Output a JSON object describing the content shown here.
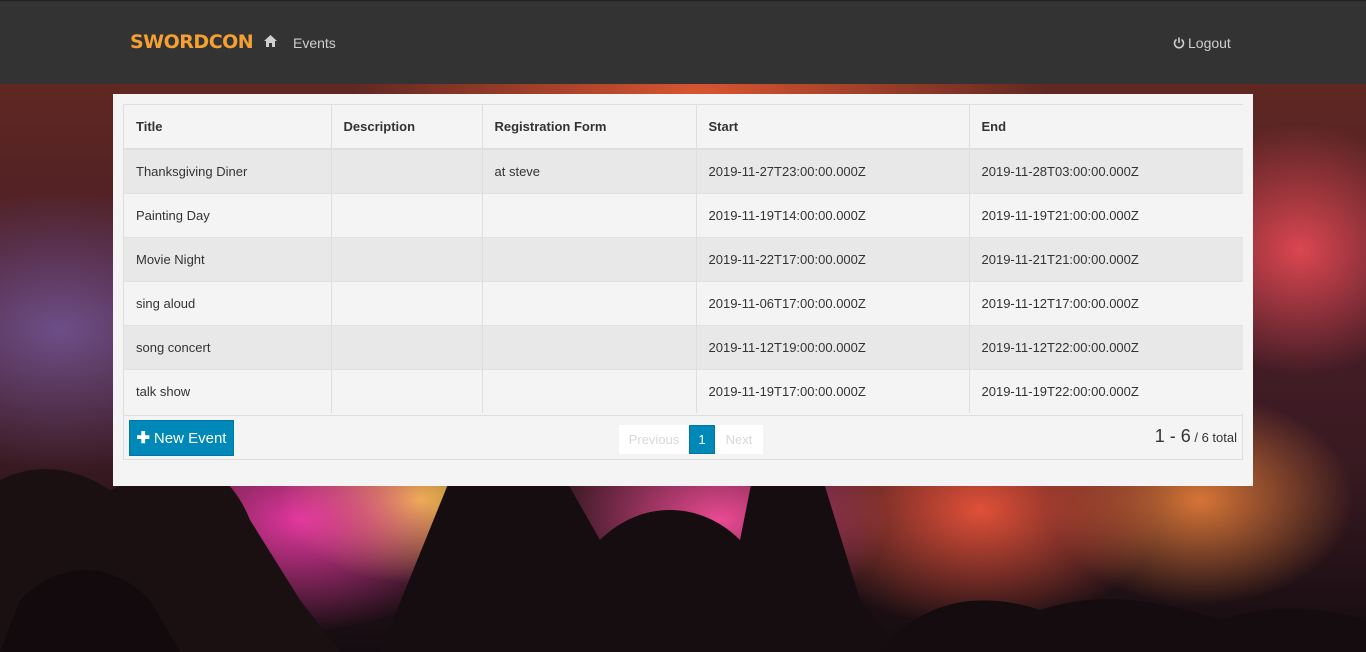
{
  "brand": {
    "logo_text": "SWORDCON",
    "accent_color": "#f5a033"
  },
  "nav": {
    "home_icon": "home-icon",
    "events_label": "Events",
    "logout_label": "Logout",
    "logout_icon": "power-icon"
  },
  "table": {
    "columns": [
      "Title",
      "Description",
      "Registration Form",
      "Start",
      "End"
    ],
    "rows": [
      {
        "title": "Thanksgiving Diner",
        "description": "",
        "registration_form": "at steve",
        "start": "2019-11-27T23:00:00.000Z",
        "end": "2019-11-28T03:00:00.000Z"
      },
      {
        "title": "Painting Day",
        "description": "",
        "registration_form": "",
        "start": "2019-11-19T14:00:00.000Z",
        "end": "2019-11-19T21:00:00.000Z"
      },
      {
        "title": "Movie Night",
        "description": "",
        "registration_form": "",
        "start": "2019-11-22T17:00:00.000Z",
        "end": "2019-11-21T21:00:00.000Z"
      },
      {
        "title": "sing aloud",
        "description": "",
        "registration_form": "",
        "start": "2019-11-06T17:00:00.000Z",
        "end": "2019-11-12T17:00:00.000Z"
      },
      {
        "title": "song concert",
        "description": "",
        "registration_form": "",
        "start": "2019-11-12T19:00:00.000Z",
        "end": "2019-11-12T22:00:00.000Z"
      },
      {
        "title": "talk show",
        "description": "",
        "registration_form": "",
        "start": "2019-11-19T17:00:00.000Z",
        "end": "2019-11-19T22:00:00.000Z"
      }
    ]
  },
  "actions": {
    "new_event_label": "New Event",
    "new_event_color": "#0088b8"
  },
  "pagination": {
    "previous_label": "Previous",
    "current_page": "1",
    "next_label": "Next"
  },
  "summary": {
    "range": "1 - 6",
    "total": "/ 6 total"
  }
}
